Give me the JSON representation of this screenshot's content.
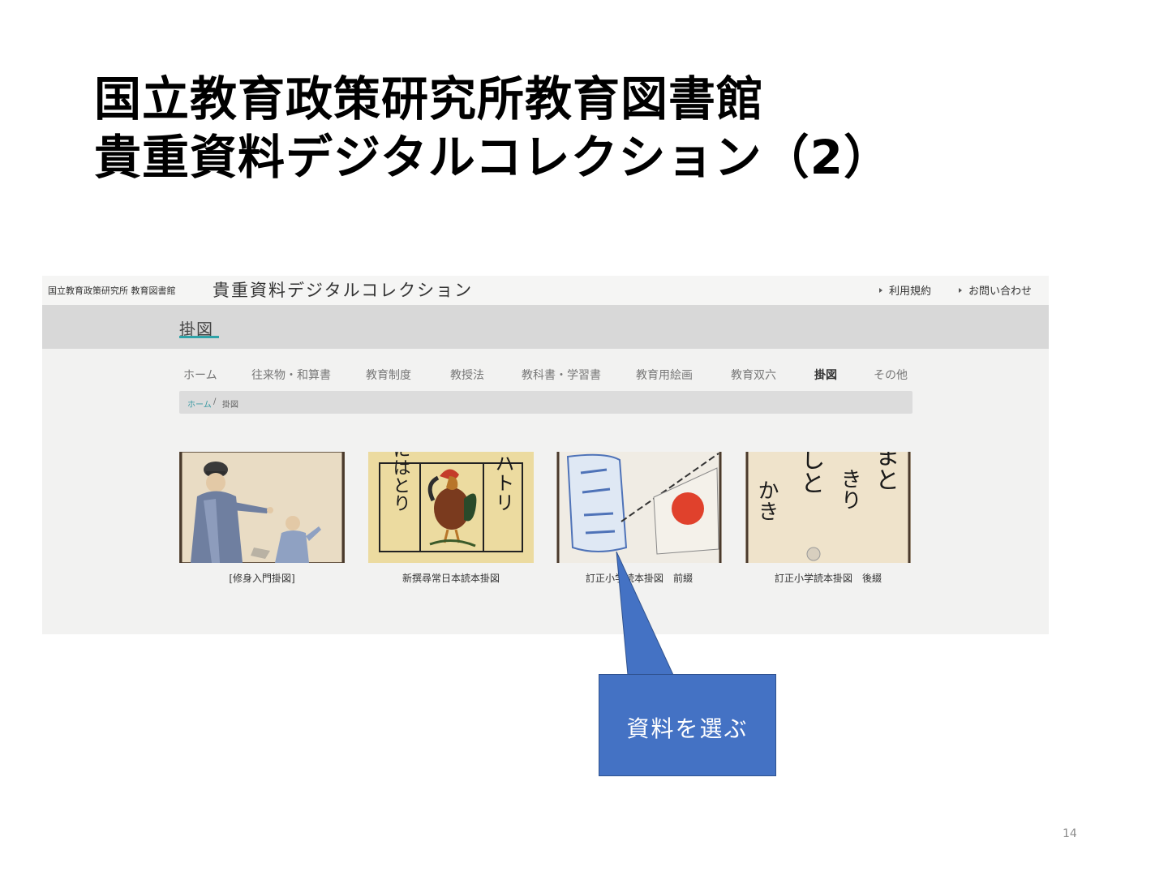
{
  "slide": {
    "title_line1": "国立教育政策研究所教育図書館",
    "title_line2": "貴重資料デジタルコレクション（2）",
    "page_number": "14"
  },
  "site": {
    "org_name": "国立教育政策研究所 教育図書館",
    "site_title": "貴重資料デジタルコレクション",
    "header_links": [
      "利用規約",
      "お問い合わせ"
    ],
    "section_title": "掛図",
    "nav": [
      "ホーム",
      "往来物・和算書",
      "教育制度",
      "教授法",
      "教科書・学習書",
      "教育用絵画",
      "教育双六",
      "掛図",
      "その他"
    ],
    "nav_active": "掛図",
    "breadcrumb": {
      "home": "ホーム",
      "separator": "/",
      "current": "掛図"
    },
    "items": [
      {
        "caption": "[修身入門掛図]",
        "thumb_art": {
          "left": "",
          "right": ""
        }
      },
      {
        "caption": "新撰尋常日本読本掛図",
        "thumb_art": {
          "left": "にはとり",
          "right": "ニハトリ"
        }
      },
      {
        "caption": "訂正小学読本掛図　前綴",
        "thumb_art": {
          "left": "",
          "right": ""
        }
      },
      {
        "caption": "訂正小学読本掛図　後綴",
        "thumb_art": {
          "left": "かき",
          "middle": "なしと",
          "right_top": "こまと",
          "right_bottom": "きり"
        }
      }
    ],
    "colors": {
      "accent": "#2fa3a8",
      "callout": "#4472c4"
    }
  },
  "callout": {
    "text": "資料を選ぶ"
  }
}
